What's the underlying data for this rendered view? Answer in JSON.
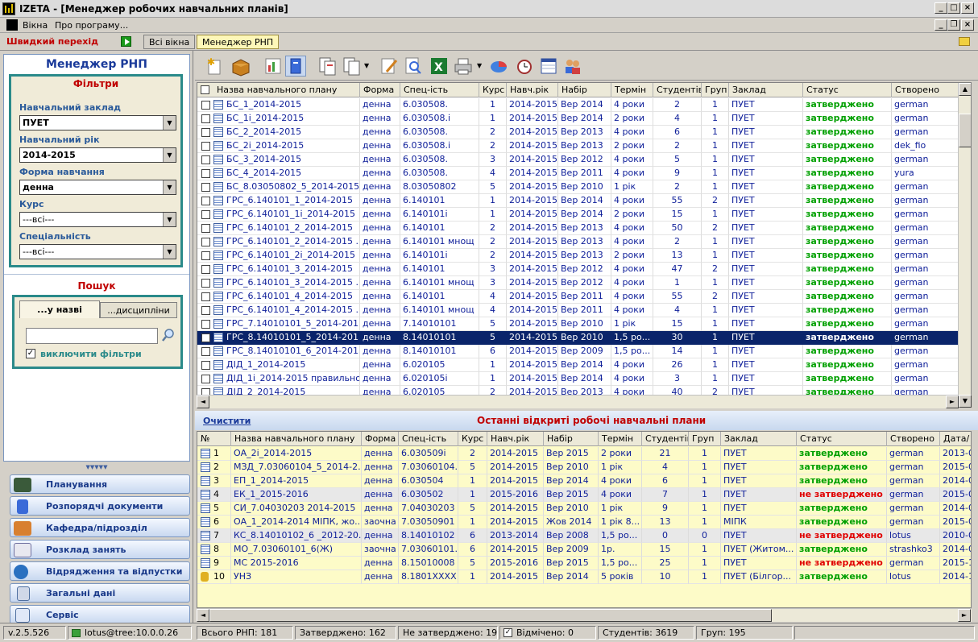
{
  "window": {
    "title": "IZETA - [Менеджер робочих навчальних планів]"
  },
  "menu": {
    "items": [
      "Вікна",
      "Про програму..."
    ]
  },
  "quickbar": {
    "label": "Швидкий перехід",
    "tab_all": "Всі вікна",
    "tab_manager": "Менеджер РНП"
  },
  "left": {
    "title": "Менеджер РНП",
    "filters_title": "Фільтри",
    "filters": [
      {
        "label": "Навчальний заклад",
        "value": "ПУЕТ"
      },
      {
        "label": "Навчальний рік",
        "value": "2014-2015"
      },
      {
        "label": "Форма навчання",
        "value": "денна"
      },
      {
        "label": "Курс",
        "value": "---всі---"
      },
      {
        "label": "Спеціальність",
        "value": "---всі---"
      }
    ],
    "search_title": "Пошук",
    "search_tabs": [
      "...у назві",
      "...дисципліни"
    ],
    "search_value": "",
    "exclude_filters": "виключити фільтри",
    "exclude_checked": true,
    "nav": [
      "Планування",
      "Розпорядчі документи",
      "Кафедра/підрозділ",
      "Розклад занять",
      "Відрядження та відпустки",
      "Загальні дані",
      "Сервіс"
    ]
  },
  "main_grid": {
    "columns": [
      "Назва навчального плану",
      "Форма",
      "Спец-ість",
      "Курс",
      "Навч.рік",
      "Набір",
      "Термін",
      "Студентів",
      "Груп",
      "Заклад",
      "Статус",
      "Створено"
    ],
    "rows": [
      [
        "БС_1_2014-2015",
        "денна",
        "6.030508.",
        "1",
        "2014-2015",
        "Вер 2014",
        "4 роки",
        "2",
        "1",
        "ПУЕТ",
        "затверджено",
        "german"
      ],
      [
        "БС_1і_2014-2015",
        "денна",
        "6.030508.і",
        "1",
        "2014-2015",
        "Вер 2014",
        "2 роки",
        "4",
        "1",
        "ПУЕТ",
        "затверджено",
        "german"
      ],
      [
        "БС_2_2014-2015",
        "денна",
        "6.030508.",
        "2",
        "2014-2015",
        "Вер 2013",
        "4 роки",
        "6",
        "1",
        "ПУЕТ",
        "затверджено",
        "german"
      ],
      [
        "БС_2і_2014-2015",
        "денна",
        "6.030508.і",
        "2",
        "2014-2015",
        "Вер 2013",
        "2 роки",
        "2",
        "1",
        "ПУЕТ",
        "затверджено",
        "dek_fio"
      ],
      [
        "БС_3_2014-2015",
        "денна",
        "6.030508.",
        "3",
        "2014-2015",
        "Вер 2012",
        "4 роки",
        "5",
        "1",
        "ПУЕТ",
        "затверджено",
        "german"
      ],
      [
        "БС_4_2014-2015",
        "денна",
        "6.030508.",
        "4",
        "2014-2015",
        "Вер 2011",
        "4 роки",
        "9",
        "1",
        "ПУЕТ",
        "затверджено",
        "yura"
      ],
      [
        "БС_8.03050802_5_2014-2015",
        "денна",
        "8.03050802",
        "5",
        "2014-2015",
        "Вер 2010",
        "1 рік",
        "2",
        "1",
        "ПУЕТ",
        "затверджено",
        "german"
      ],
      [
        "ГРС_6.140101_1_2014-2015",
        "денна",
        "6.140101",
        "1",
        "2014-2015",
        "Вер 2014",
        "4 роки",
        "55",
        "2",
        "ПУЕТ",
        "затверджено",
        "german"
      ],
      [
        "ГРС_6.140101_1і_2014-2015",
        "денна",
        "6.140101і",
        "1",
        "2014-2015",
        "Вер 2014",
        "2 роки",
        "15",
        "1",
        "ПУЕТ",
        "затверджено",
        "german"
      ],
      [
        "ГРС_6.140101_2_2014-2015",
        "денна",
        "6.140101",
        "2",
        "2014-2015",
        "Вер 2013",
        "4 роки",
        "50",
        "2",
        "ПУЕТ",
        "затверджено",
        "german"
      ],
      [
        "ГРС_6.140101_2_2014-2015 ...",
        "денна",
        "6.140101 мнощ",
        "2",
        "2014-2015",
        "Вер 2013",
        "4 роки",
        "2",
        "1",
        "ПУЕТ",
        "затверджено",
        "german"
      ],
      [
        "ГРС_6.140101_2і_2014-2015",
        "денна",
        "6.140101і",
        "2",
        "2014-2015",
        "Вер 2013",
        "2 роки",
        "13",
        "1",
        "ПУЕТ",
        "затверджено",
        "german"
      ],
      [
        "ГРС_6.140101_3_2014-2015",
        "денна",
        "6.140101",
        "3",
        "2014-2015",
        "Вер 2012",
        "4 роки",
        "47",
        "2",
        "ПУЕТ",
        "затверджено",
        "german"
      ],
      [
        "ГРС_6.140101_3_2014-2015 ...",
        "денна",
        "6.140101 мнощ",
        "3",
        "2014-2015",
        "Вер 2012",
        "4 роки",
        "1",
        "1",
        "ПУЕТ",
        "затверджено",
        "german"
      ],
      [
        "ГРС_6.140101_4_2014-2015",
        "денна",
        "6.140101",
        "4",
        "2014-2015",
        "Вер 2011",
        "4 роки",
        "55",
        "2",
        "ПУЕТ",
        "затверджено",
        "german"
      ],
      [
        "ГРС_6.140101_4_2014-2015 ...",
        "денна",
        "6.140101 мнощ",
        "4",
        "2014-2015",
        "Вер 2011",
        "4 роки",
        "4",
        "1",
        "ПУЕТ",
        "затверджено",
        "german"
      ],
      [
        "ГРС_7.14010101_5_2014-2015",
        "денна",
        "7.14010101",
        "5",
        "2014-2015",
        "Вер 2010",
        "1 рік",
        "15",
        "1",
        "ПУЕТ",
        "затверджено",
        "german"
      ],
      [
        "ГРС_8.14010101_5_2014-2015",
        "денна",
        "8.14010101",
        "5",
        "2014-2015",
        "Вер 2010",
        "1,5 ро...",
        "30",
        "1",
        "ПУЕТ",
        "затверджено",
        "german"
      ],
      [
        "ГРС_8.14010101_6_2014-2015",
        "денна",
        "8.14010101",
        "6",
        "2014-2015",
        "Вер 2009",
        "1,5 ро...",
        "14",
        "1",
        "ПУЕТ",
        "затверджено",
        "german"
      ],
      [
        "ДІД_1_2014-2015",
        "денна",
        "6.020105",
        "1",
        "2014-2015",
        "Вер 2014",
        "4 роки",
        "26",
        "1",
        "ПУЕТ",
        "затверджено",
        "german"
      ],
      [
        "ДІД_1і_2014-2015 правильно ...",
        "денна",
        "6.020105і",
        "1",
        "2014-2015",
        "Вер 2014",
        "4 роки",
        "3",
        "1",
        "ПУЕТ",
        "затверджено",
        "german"
      ],
      [
        "ДІД_2_2014-2015",
        "денна",
        "6.020105",
        "2",
        "2014-2015",
        "Вер 2013",
        "4 роки",
        "40",
        "2",
        "ПУЕТ",
        "затверджено",
        "german"
      ]
    ],
    "selected_row": 17
  },
  "recent": {
    "clear": "Очистити",
    "title": "Останні відкриті робочі навчальні плани",
    "columns": [
      "№",
      "Назва навчального плану",
      "Форма",
      "Спец-ість",
      "Курс",
      "Навч.рік",
      "Набір",
      "Термін",
      "Студентів",
      "Груп",
      "Заклад",
      "Статус",
      "Створено",
      "Дата/"
    ],
    "rows": [
      {
        "n": "1",
        "cells": [
          "ОА_2і_2014-2015",
          "денна",
          "6.030509і",
          "2",
          "2014-2015",
          "Вер 2015",
          "2 роки",
          "21",
          "1",
          "ПУЕТ",
          "затверджено",
          "german",
          "2013-0"
        ],
        "bg": "y",
        "st": "g"
      },
      {
        "n": "2",
        "cells": [
          "МЗД_7.03060104_5_2014-2...",
          "денна",
          "7.03060104.",
          "5",
          "2014-2015",
          "Вер 2010",
          "1 рік",
          "4",
          "1",
          "ПУЕТ",
          "затверджено",
          "german",
          "2015-0"
        ],
        "bg": "y",
        "st": "g"
      },
      {
        "n": "3",
        "cells": [
          "ЕП_1_2014-2015",
          "денна",
          "6.030504",
          "1",
          "2014-2015",
          "Вер 2014",
          "4 роки",
          "6",
          "1",
          "ПУЕТ",
          "затверджено",
          "german",
          "2014-0"
        ],
        "bg": "y",
        "st": "g"
      },
      {
        "n": "4",
        "cells": [
          "ЕК_1_2015-2016",
          "денна",
          "6.030502",
          "1",
          "2015-2016",
          "Вер 2015",
          "4 роки",
          "7",
          "1",
          "ПУЕТ",
          "не затверджено",
          "german",
          "2015-0"
        ],
        "bg": "g",
        "st": "r"
      },
      {
        "n": "5",
        "cells": [
          "СИ_7.04030203 2014-2015",
          "денна",
          "7.04030203",
          "5",
          "2014-2015",
          "Вер 2010",
          "1 рік",
          "9",
          "1",
          "ПУЕТ",
          "затверджено",
          "german",
          "2014-0"
        ],
        "bg": "y",
        "st": "g"
      },
      {
        "n": "6",
        "cells": [
          "ОА_1_2014-2014 МІПК, жо...",
          "заочна",
          "7.03050901",
          "1",
          "2014-2015",
          "Жов 2014",
          "1 рік 8...",
          "13",
          "1",
          "МІПК",
          "затверджено",
          "german",
          "2015-0"
        ],
        "bg": "y",
        "st": "g"
      },
      {
        "n": "7",
        "cells": [
          "КС_8.14010102_6 _2012-20...",
          "денна",
          "8.14010102",
          "6",
          "2013-2014",
          "Вер 2008",
          "1,5 ро...",
          "0",
          "0",
          "ПУЕТ",
          "не затверджено",
          "lotus",
          "2010-0"
        ],
        "bg": "g",
        "st": "r"
      },
      {
        "n": "8",
        "cells": [
          "МО_7.03060101_6(Ж)",
          "заочна",
          "7.03060101.",
          "6",
          "2014-2015",
          "Вер 2009",
          "1р.",
          "15",
          "1",
          "ПУЕТ (Житом...",
          "затверджено",
          "strashko3",
          "2014-0"
        ],
        "bg": "y",
        "st": "g"
      },
      {
        "n": "9",
        "cells": [
          "МС 2015-2016",
          "денна",
          "8.15010008",
          "5",
          "2015-2016",
          "Вер 2015",
          "1,5 ро...",
          "25",
          "1",
          "ПУЕТ",
          "не затверджено",
          "german",
          "2015-1"
        ],
        "bg": "y",
        "st": "r"
      },
      {
        "n": "10",
        "cells": [
          "УНЗ",
          "денна",
          "8.1801XXXX",
          "1",
          "2014-2015",
          "Вер 2014",
          "5 років",
          "10",
          "1",
          "ПУЕТ (Білгор...",
          "затверджено",
          "lotus",
          "2014-1"
        ],
        "bg": "y",
        "st": "g"
      }
    ]
  },
  "status": {
    "version": "v.2.5.526",
    "connection": "lotus@tree:10.0.0.26",
    "total": "Всього РНП: 181",
    "approved": "Затверджено: 162",
    "not_approved": "Не затверджено: 19",
    "marked": "Відмічено: 0",
    "students": "Студентів: 3619",
    "groups": "Груп: 195"
  },
  "colors": {
    "selected": "#0a246a",
    "approved": "#00a000",
    "not_approved": "#e00000",
    "recent_yellow": "#fdfbc8"
  }
}
